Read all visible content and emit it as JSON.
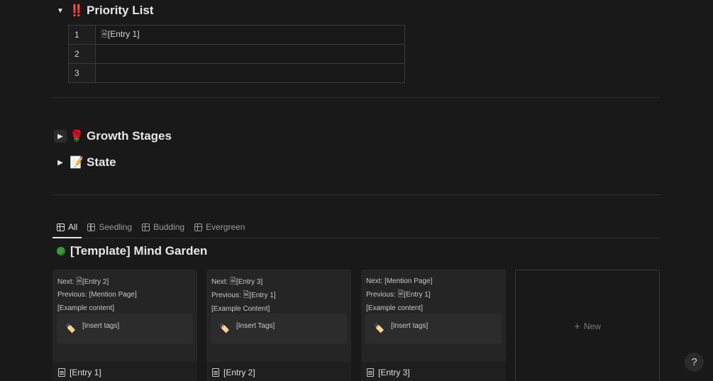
{
  "sections": {
    "priority": {
      "emoji": "‼️",
      "title": "Priority List"
    },
    "growth": {
      "emoji": "🌹",
      "title": "Growth Stages"
    },
    "state": {
      "emoji": "📝",
      "title": "State"
    }
  },
  "priority_table": {
    "rows": [
      {
        "num": "1",
        "value": "[Entry 1]"
      },
      {
        "num": "2",
        "value": ""
      },
      {
        "num": "3",
        "value": ""
      }
    ]
  },
  "tabs": [
    {
      "label": "All"
    },
    {
      "label": "Seedling"
    },
    {
      "label": "Budding"
    },
    {
      "label": "Evergreen"
    }
  ],
  "database": {
    "title": "[Template] Mind Garden"
  },
  "cards": [
    {
      "next": "Next: ",
      "next_link": "[Entry 2]",
      "previous": "Previous: [Mention Page]",
      "content": "[Example content]",
      "tags": "[Insert tags]",
      "title": "[Entry 1]"
    },
    {
      "next": "Next: ",
      "next_link": "[Entry 3]",
      "previous": "Previous: ",
      "previous_link": "[Entry 1]",
      "content": "[Example Content]",
      "tags": "[Insert Tags]",
      "title": "[Entry 2]"
    },
    {
      "next": "Next: [Mention Page]",
      "previous": "Previous: ",
      "previous_link": "[Entry 1]",
      "content": "[Example content]",
      "tags": "[Insert tags]",
      "title": "[Entry 3]"
    }
  ],
  "new_card": {
    "label": "New"
  },
  "help": {
    "label": "?"
  },
  "colors": {
    "background": "#191919",
    "card": "#252525",
    "accent_green": "#3c9a3a"
  }
}
